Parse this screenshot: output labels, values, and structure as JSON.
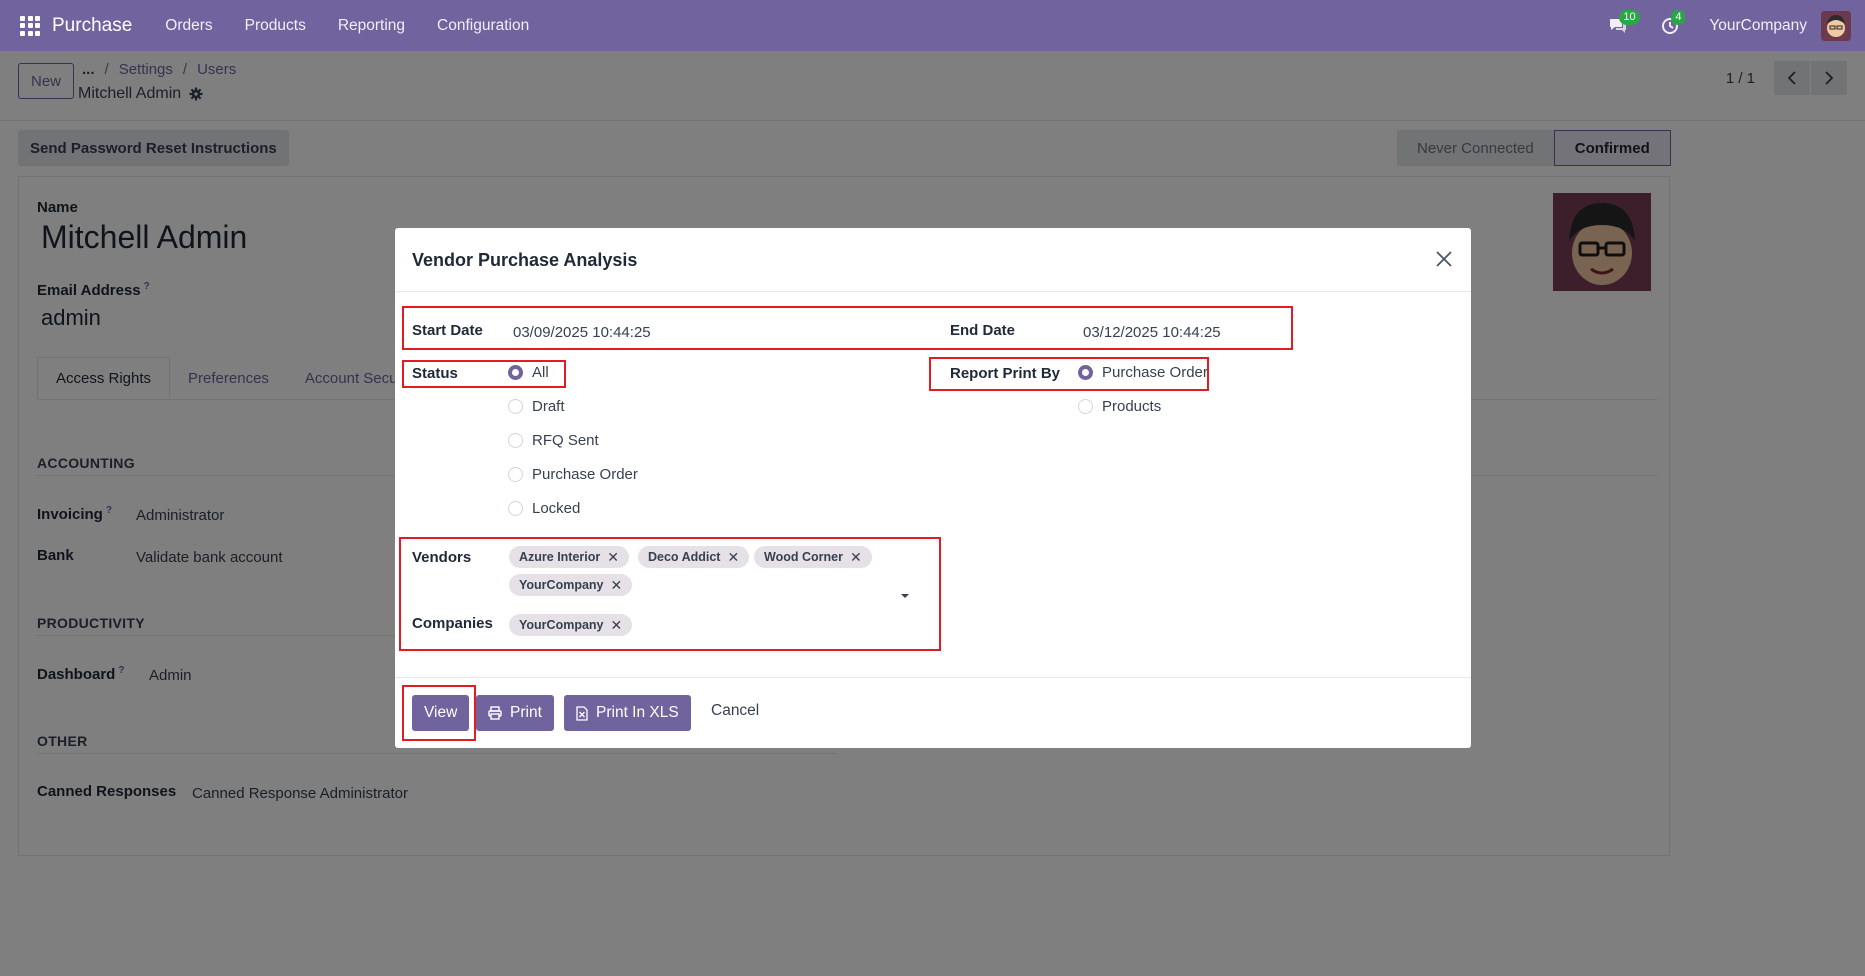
{
  "topnav": {
    "app_name": "Purchase",
    "menu": [
      "Orders",
      "Products",
      "Reporting",
      "Configuration"
    ],
    "messages_badge": "10",
    "activity_badge": "4",
    "company": "YourCompany"
  },
  "control_panel": {
    "new_label": "New",
    "breadcrumb_more": "...",
    "breadcrumbs": [
      "Settings",
      "Users"
    ],
    "record_name": "Mitchell Admin",
    "pager": "1 / 1"
  },
  "form": {
    "reset_button": "Send Password Reset Instructions",
    "status_steps": [
      "Never Connected",
      "Confirmed"
    ],
    "name_label": "Name",
    "name_value": "Mitchell Admin",
    "email_label": "Email Address",
    "email_value": "admin",
    "tabs": [
      "Access Rights",
      "Preferences",
      "Account Secu"
    ],
    "sections": {
      "accounting": "ACCOUNTING",
      "productivity": "PRODUCTIVITY",
      "other": "OTHER"
    },
    "fields": {
      "invoicing_label": "Invoicing",
      "invoicing_value": "Administrator",
      "bank_label": "Bank",
      "bank_value": "Validate bank account",
      "dashboard_label": "Dashboard",
      "dashboard_value": "Admin",
      "canned_label": "Canned Responses",
      "canned_value": "Canned Response Administrator"
    }
  },
  "modal": {
    "title": "Vendor Purchase Analysis",
    "start_date_label": "Start Date",
    "start_date_value": "03/09/2025 10:44:25",
    "end_date_label": "End Date",
    "end_date_value": "03/12/2025 10:44:25",
    "status_label": "Status",
    "status_options": [
      "All",
      "Draft",
      "RFQ Sent",
      "Purchase Order",
      "Locked"
    ],
    "status_selected": "All",
    "report_by_label": "Report Print By",
    "report_by_options": [
      "Purchase Order",
      "Products"
    ],
    "report_by_selected": "Purchase Order",
    "vendors_label": "Vendors",
    "vendors": [
      "Azure Interior",
      "Deco Addict",
      "Wood Corner",
      "YourCompany"
    ],
    "companies_label": "Companies",
    "companies": [
      "YourCompany"
    ],
    "buttons": {
      "view": "View",
      "print": "Print",
      "print_xls": "Print In XLS",
      "cancel": "Cancel"
    }
  },
  "colors": {
    "brand": "#71639e",
    "highlight": "#e31b23",
    "badge": "#28a745"
  }
}
